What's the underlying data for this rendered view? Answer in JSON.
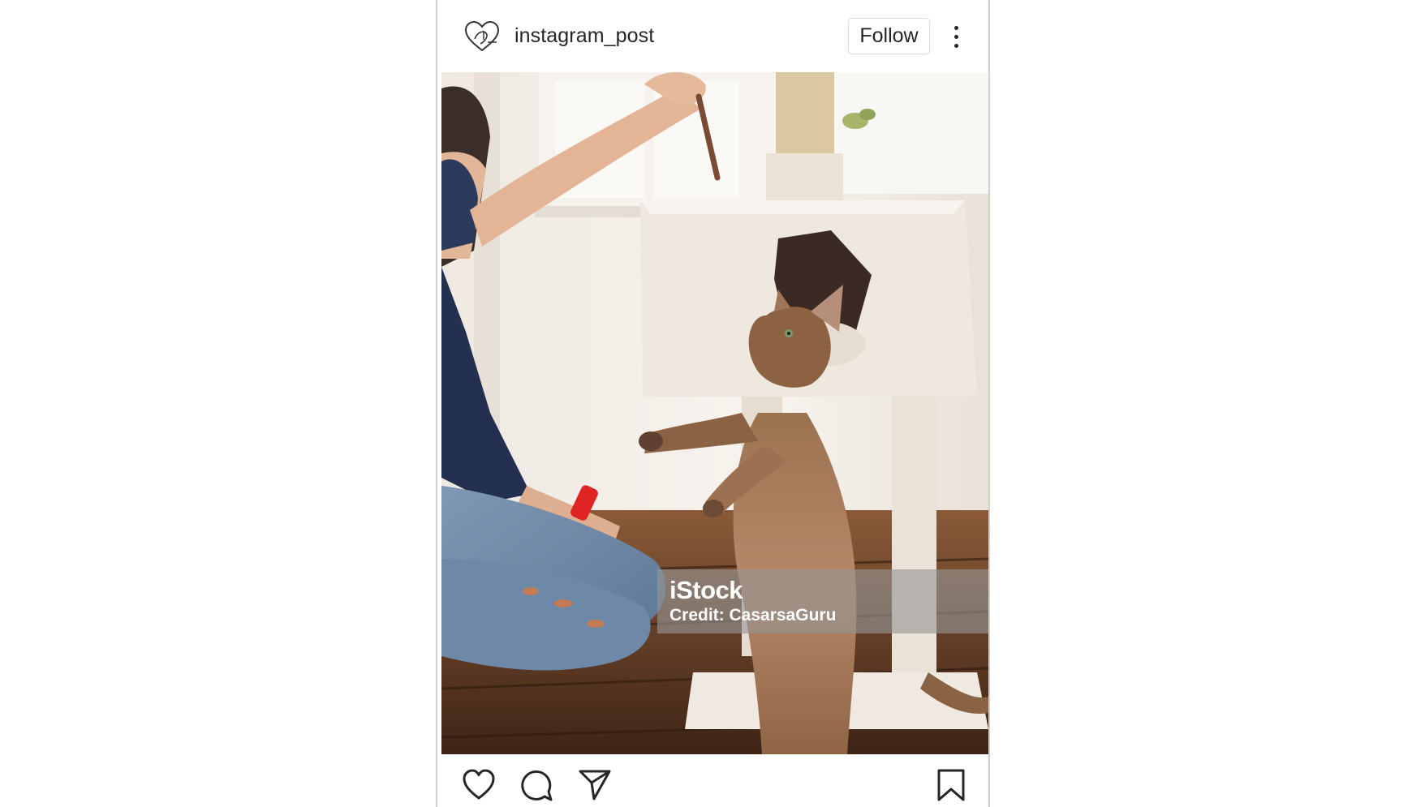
{
  "post": {
    "username": "instagram_post",
    "follow_label": "Follow",
    "photo": {
      "alt": "Woman playing with a curly-coated cat near a cat tree",
      "watermark_brand": "iStock",
      "watermark_credit": "Credit: CasarsaGuru"
    }
  },
  "icons": {
    "avatar": "heart-logo-icon",
    "more": "more-vertical-icon",
    "like": "heart-icon",
    "comment": "comment-icon",
    "share": "send-icon",
    "save": "bookmark-icon"
  },
  "colors": {
    "text": "#262626",
    "border": "#dbdbdb",
    "background": "#ffffff"
  }
}
